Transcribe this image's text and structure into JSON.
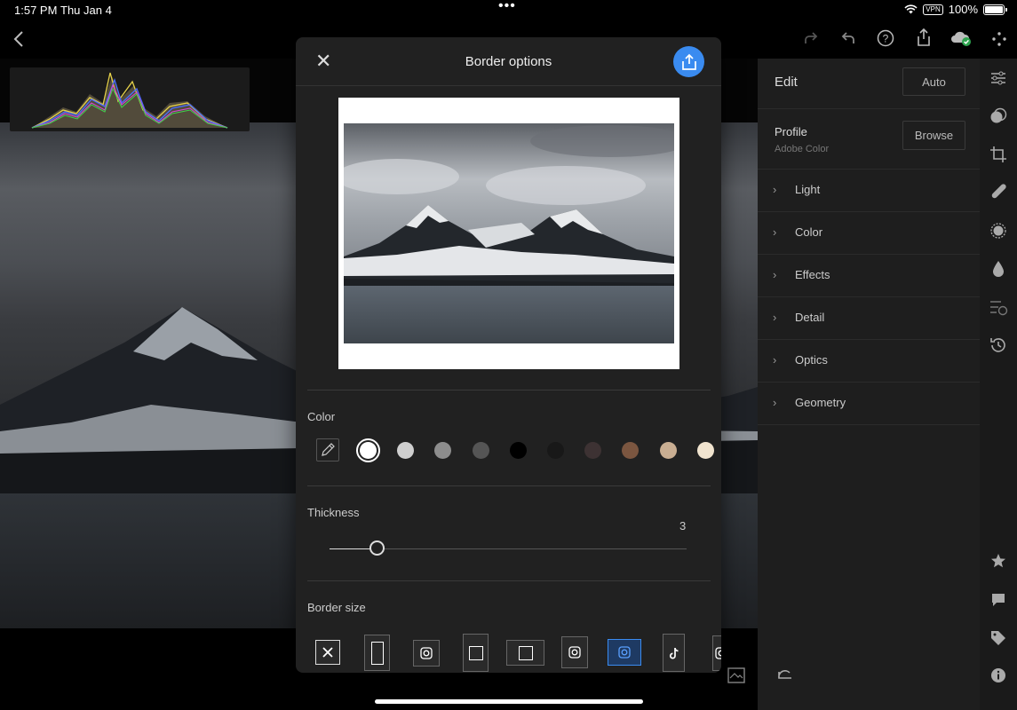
{
  "status_bar": {
    "time": "1:57 PM",
    "date": "Thu Jan 4",
    "vpn": "VPN",
    "battery": "100%"
  },
  "right_panel": {
    "title": "Edit",
    "auto_label": "Auto",
    "profile_label": "Profile",
    "profile_value": "Adobe Color",
    "browse_label": "Browse",
    "sections": [
      "Light",
      "Color",
      "Effects",
      "Detail",
      "Optics",
      "Geometry"
    ]
  },
  "dialog": {
    "title": "Border options",
    "color_label": "Color",
    "swatch_colors": [
      "#ffffff",
      "#cfcfcf",
      "#8d8d8d",
      "#555555",
      "#000000",
      "#181818",
      "#3d3233",
      "#7b5640",
      "#c9ae92",
      "#f1e4cf"
    ],
    "selected_swatch": 0,
    "thickness_label": "Thickness",
    "thickness_value": "3",
    "border_size_label": "Border size",
    "selected_border_size": 6
  },
  "colors": {
    "accent": "#3a8bf0",
    "panel": "#1e1e1e",
    "dialog": "#212121"
  },
  "icons": [
    "back-chevron-icon",
    "redo-icon",
    "undo-icon",
    "help-icon",
    "share-icon",
    "cloud-sync-icon",
    "more-icon",
    "sliders-icon",
    "mask-icon",
    "crop-icon",
    "healing-icon",
    "blur-icon",
    "color-mix-icon",
    "presets-icon",
    "history-icon",
    "star-icon",
    "comment-icon",
    "tag-icon",
    "info-icon",
    "reset-icon",
    "compare-icon"
  ]
}
